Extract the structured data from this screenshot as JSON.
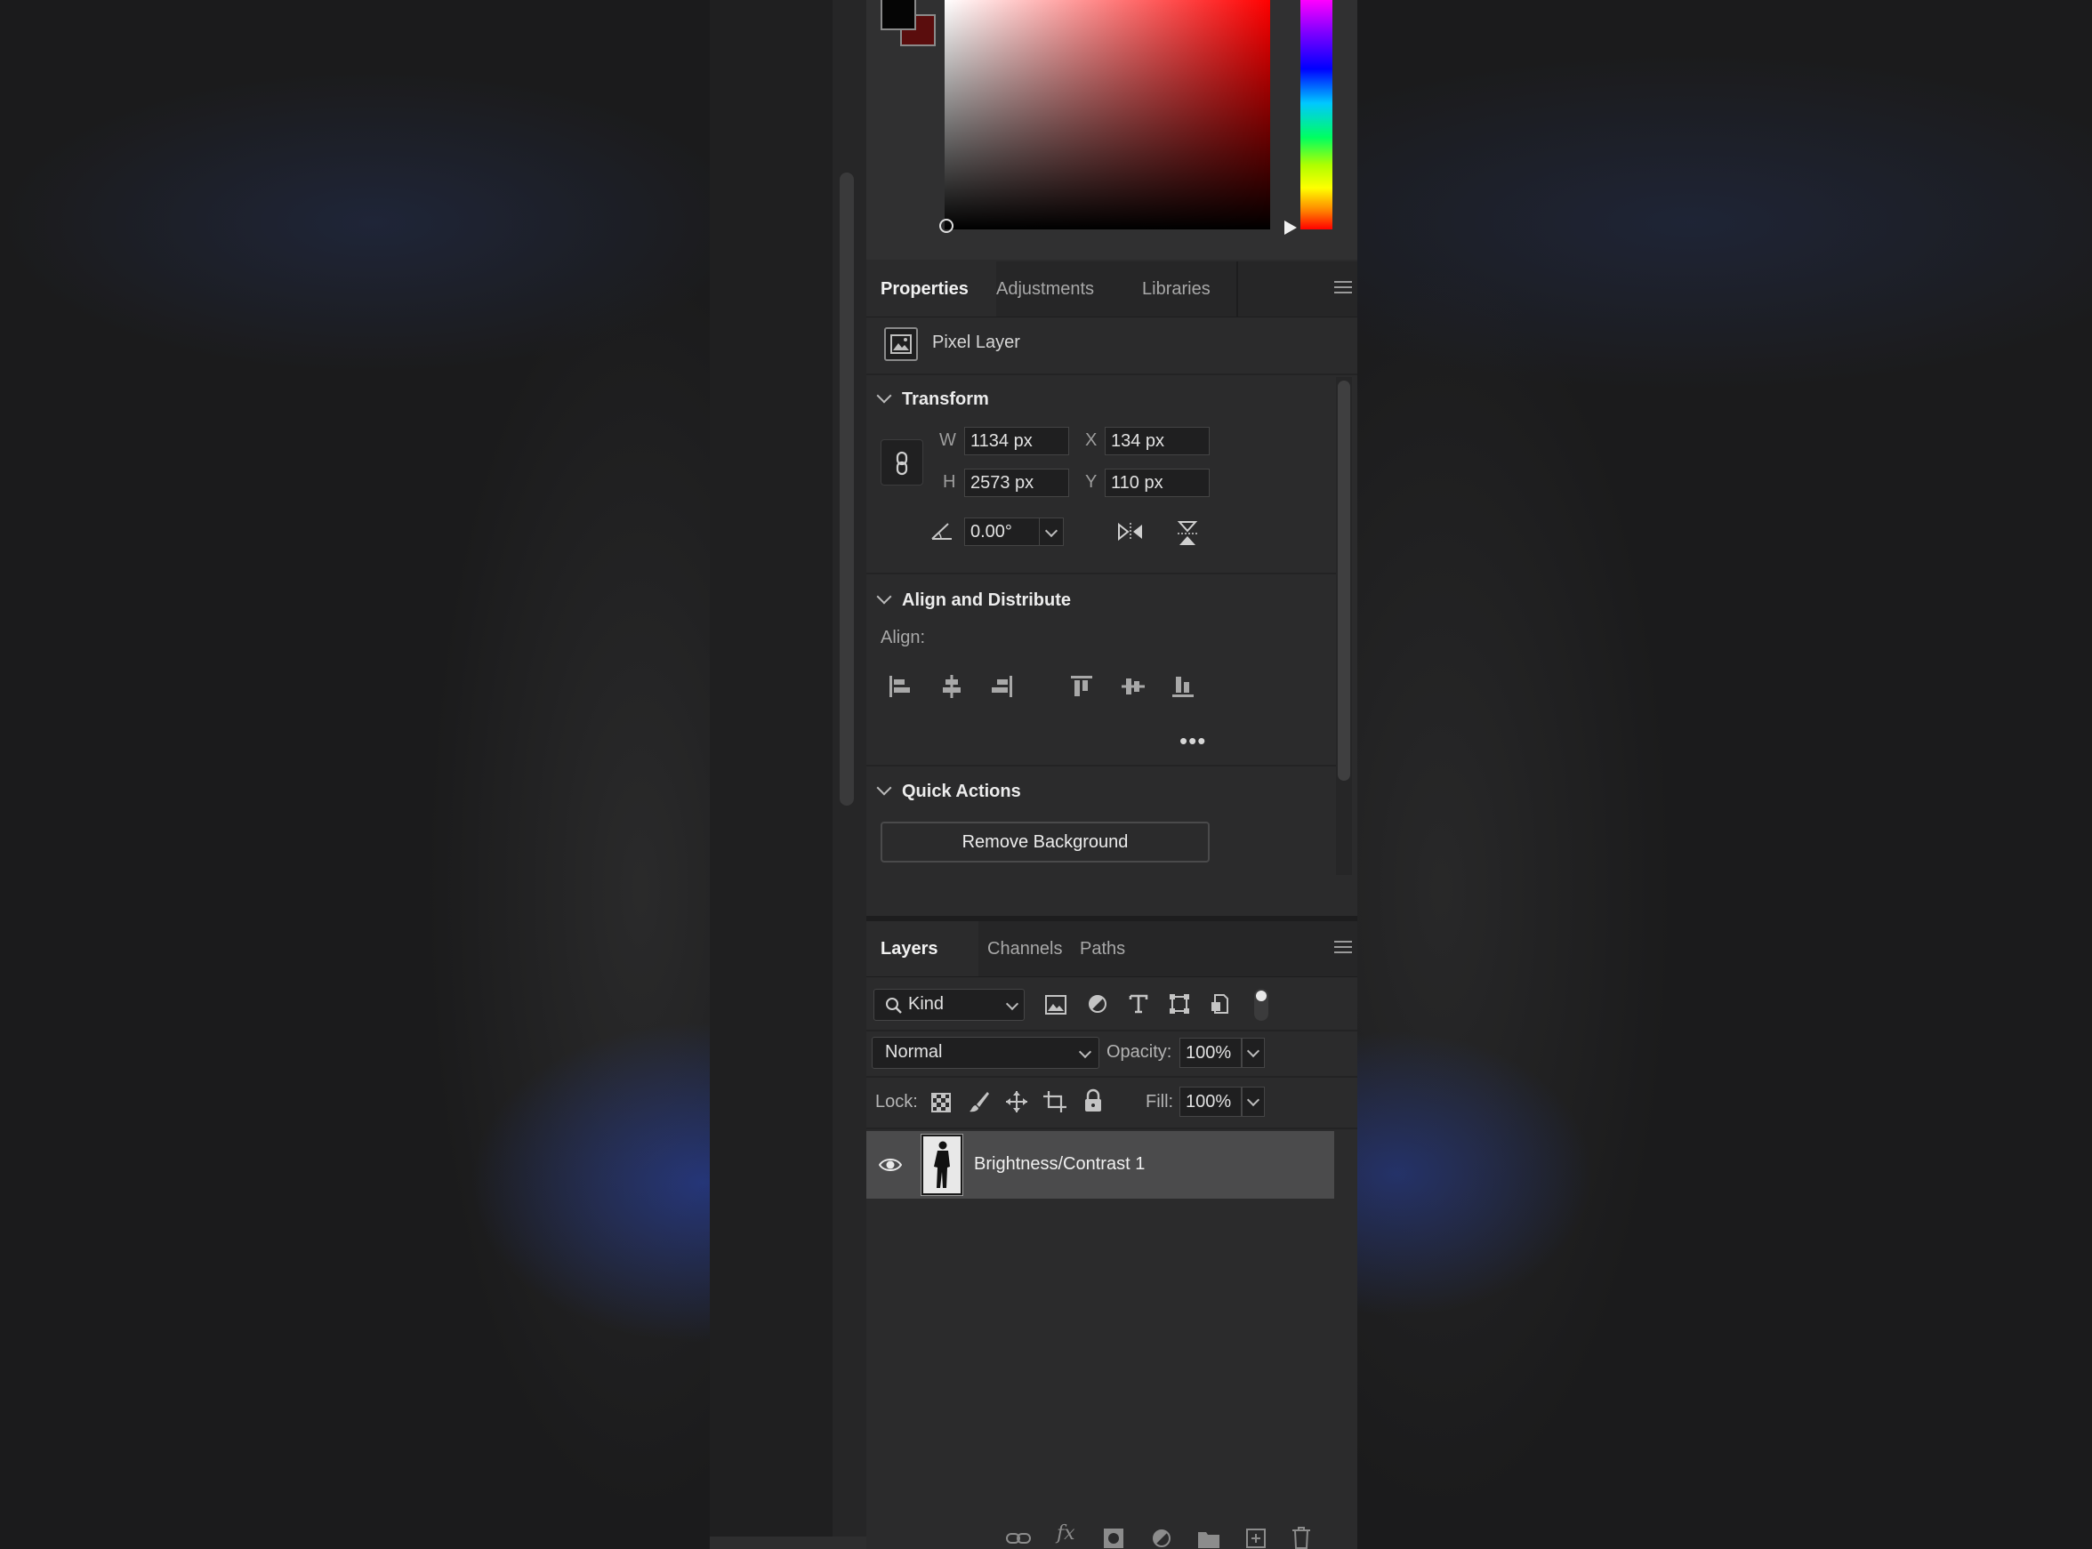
{
  "properties_panel": {
    "tabs": [
      "Properties",
      "Adjustments",
      "Libraries"
    ],
    "layer_type": "Pixel Layer",
    "transform": {
      "heading": "Transform",
      "w_label": "W",
      "w_value": "1134 px",
      "x_label": "X",
      "x_value": "134 px",
      "h_label": "H",
      "h_value": "2573 px",
      "y_label": "Y",
      "y_value": "110 px",
      "angle_value": "0.00°"
    },
    "align": {
      "heading": "Align and Distribute",
      "label": "Align:",
      "more": "•••"
    },
    "quick_actions": {
      "heading": "Quick Actions",
      "remove_background": "Remove Background"
    }
  },
  "layers_panel": {
    "tabs": [
      "Layers",
      "Channels",
      "Paths"
    ],
    "filter_kind": "Kind",
    "blend_mode": "Normal",
    "opacity_label": "Opacity:",
    "opacity_value": "100%",
    "lock_label": "Lock:",
    "fill_label": "Fill:",
    "fill_value": "100%",
    "layers": [
      {
        "name": "Brightness/Contrast 1",
        "visible": true,
        "selected": true
      }
    ]
  },
  "colors": {
    "foreground": "#050505",
    "background": "#5a0d0d",
    "hue": "#ff0000",
    "panel_bg": "#2b2b2c",
    "selected_row": "#4b4b4c"
  }
}
